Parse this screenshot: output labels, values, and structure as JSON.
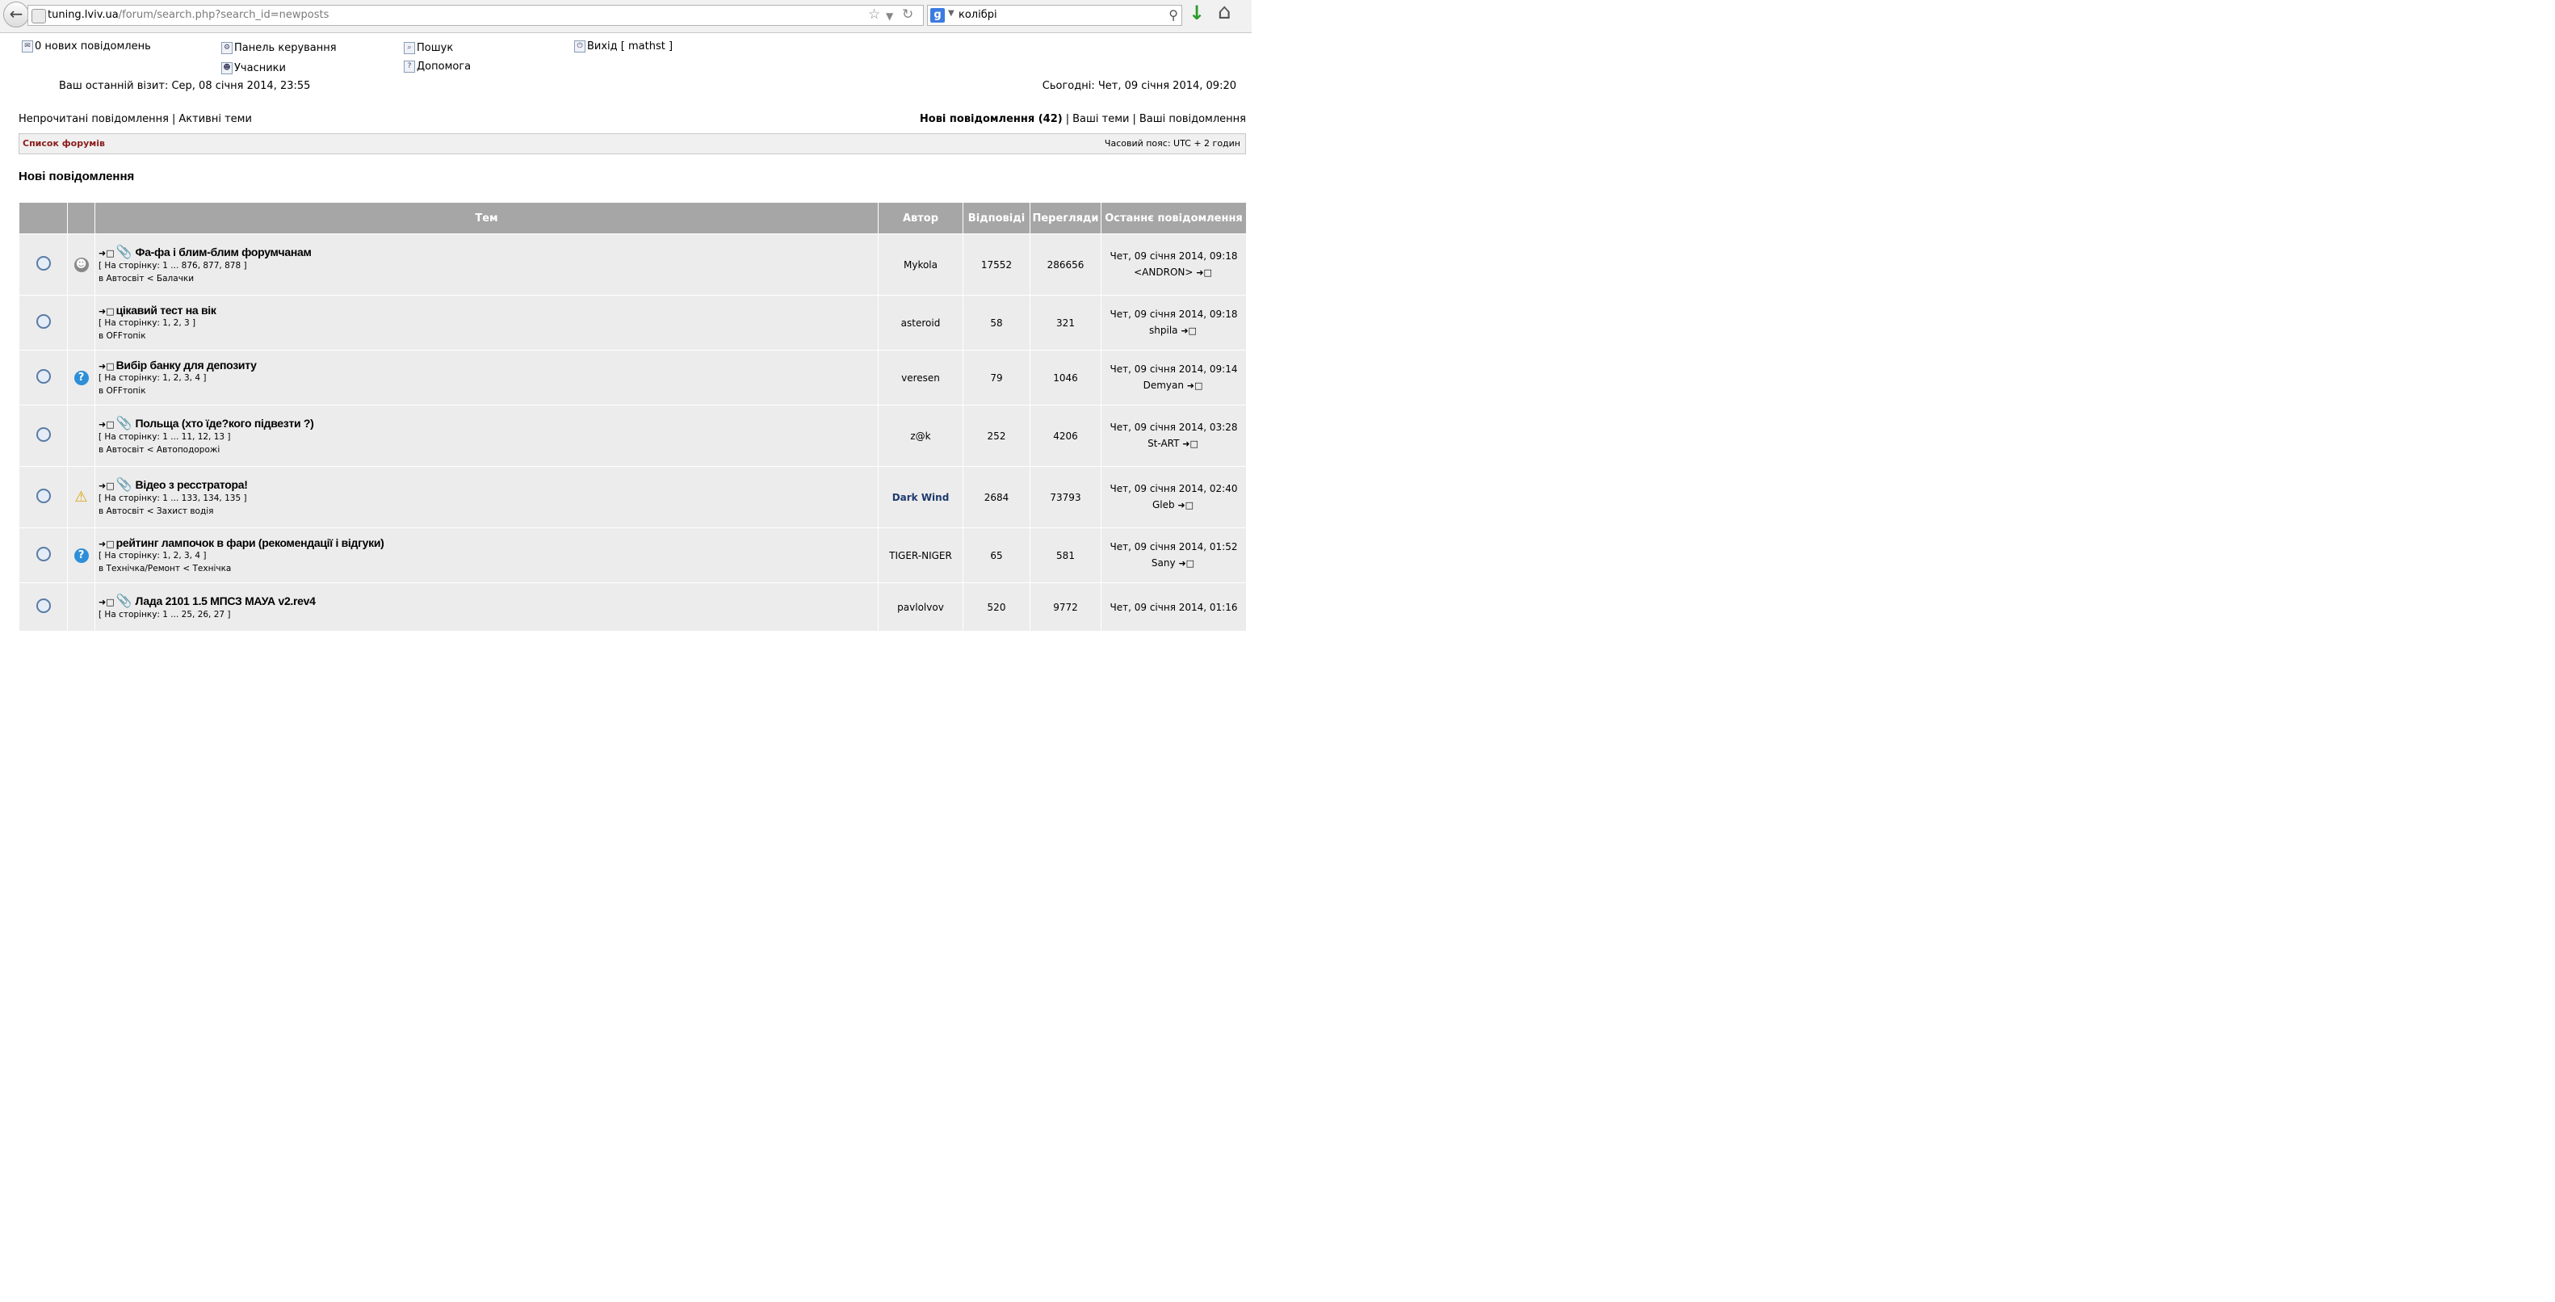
{
  "browser": {
    "url_domain": "tuning.lviv.ua",
    "url_path": "/forum/search.php?search_id=newposts",
    "search_query": "колібрі",
    "search_engine_letter": "g"
  },
  "header": {
    "new_messages": "0 нових повідомлень",
    "control_panel": "Панель керування",
    "search": "Пошук",
    "logout": "Вихід [ mathst ]",
    "members": "Учасники",
    "help": "Допомога",
    "last_visit": "Ваш останній візит: Сер, 08 січня 2014, 23:55",
    "today": "Сьогодні: Чет, 09 січня 2014, 09:20"
  },
  "links": {
    "unread": "Непрочитані повідомлення",
    "active": "Активні теми",
    "new_posts": "Нові повідомлення (42)",
    "your_topics": "Ваші теми",
    "your_posts": "Ваші повідомлення"
  },
  "nav": {
    "forum_list": "Список форумів",
    "timezone": "Часовий пояс: UTC + 2 годин"
  },
  "page_title": "Нові повідомлення",
  "table": {
    "headers": [
      "Тем",
      "Автор",
      "Відповіді",
      "Перегляди",
      "Останнє повідомлення"
    ],
    "rows": [
      {
        "type": "smile",
        "attach": true,
        "title": "Фа-фа і блим-блим форумчанам",
        "pages": "[ На сторінку: 1 ... 876, 877, 878 ]",
        "forum": "в Автосвіт < Балачки",
        "author": "Mykola",
        "replies": "17552",
        "views": "286656",
        "last_date": "Чет, 09 січня 2014, 09:18",
        "last_user": "<ANDRON>",
        "status": "hot"
      },
      {
        "type": "",
        "attach": false,
        "title": "цікавий тест на вік",
        "pages": "[ На сторінку: 1, 2, 3 ]",
        "forum": "в OFFтопік",
        "author": "asteroid",
        "replies": "58",
        "views": "321",
        "last_date": "Чет, 09 січня 2014, 09:18",
        "last_user": "shpila",
        "status": "normal"
      },
      {
        "type": "question",
        "attach": false,
        "title": "Вибір банку для депозиту",
        "pages": "[ На сторінку: 1, 2, 3, 4 ]",
        "forum": "в OFFтопік",
        "author": "veresen",
        "replies": "79",
        "views": "1046",
        "last_date": "Чет, 09 січня 2014, 09:14",
        "last_user": "Demyan",
        "status": "normal"
      },
      {
        "type": "",
        "attach": true,
        "title": "Польща (хто їде?кого підвезти ?)",
        "pages": "[ На сторінку: 1 ... 11, 12, 13 ]",
        "forum": "в Автосвіт < Автоподорожі",
        "author": "z@k",
        "replies": "252",
        "views": "4206",
        "last_date": "Чет, 09 січня 2014, 03:28",
        "last_user": "St-ART",
        "status": "normal"
      },
      {
        "type": "warning",
        "attach": true,
        "title": "Відео з ресстратора!",
        "pages": "[ На сторінку: 1 ... 133, 134, 135 ]",
        "forum": "в Автосвіт < Захист водія",
        "author": "Dark Wind",
        "replies": "2684",
        "views": "73793",
        "last_date": "Чет, 09 січня 2014, 02:40",
        "last_user": "Gleb",
        "status": "hot"
      },
      {
        "type": "question",
        "attach": false,
        "title": "рейтинг лампочок в фари (рекомендації і відгуки)",
        "pages": "[ На сторінку: 1, 2, 3, 4 ]",
        "forum": "в Технічка/Ремонт < Технічка",
        "author": "TIGER-NIGER",
        "replies": "65",
        "views": "581",
        "last_date": "Чет, 09 січня 2014, 01:52",
        "last_user": "Sany",
        "status": "normal"
      },
      {
        "type": "",
        "attach": true,
        "title": "Лада 2101 1.5 МПСЗ МАУА v2.rev4",
        "pages": "[ На сторінку: 1 ... 25, 26, 27 ]",
        "forum": "",
        "author": "pavlolvov",
        "replies": "520",
        "views": "9772",
        "last_date": "Чет, 09 січня 2014, 01:16",
        "last_user": "",
        "status": "normal"
      }
    ]
  }
}
